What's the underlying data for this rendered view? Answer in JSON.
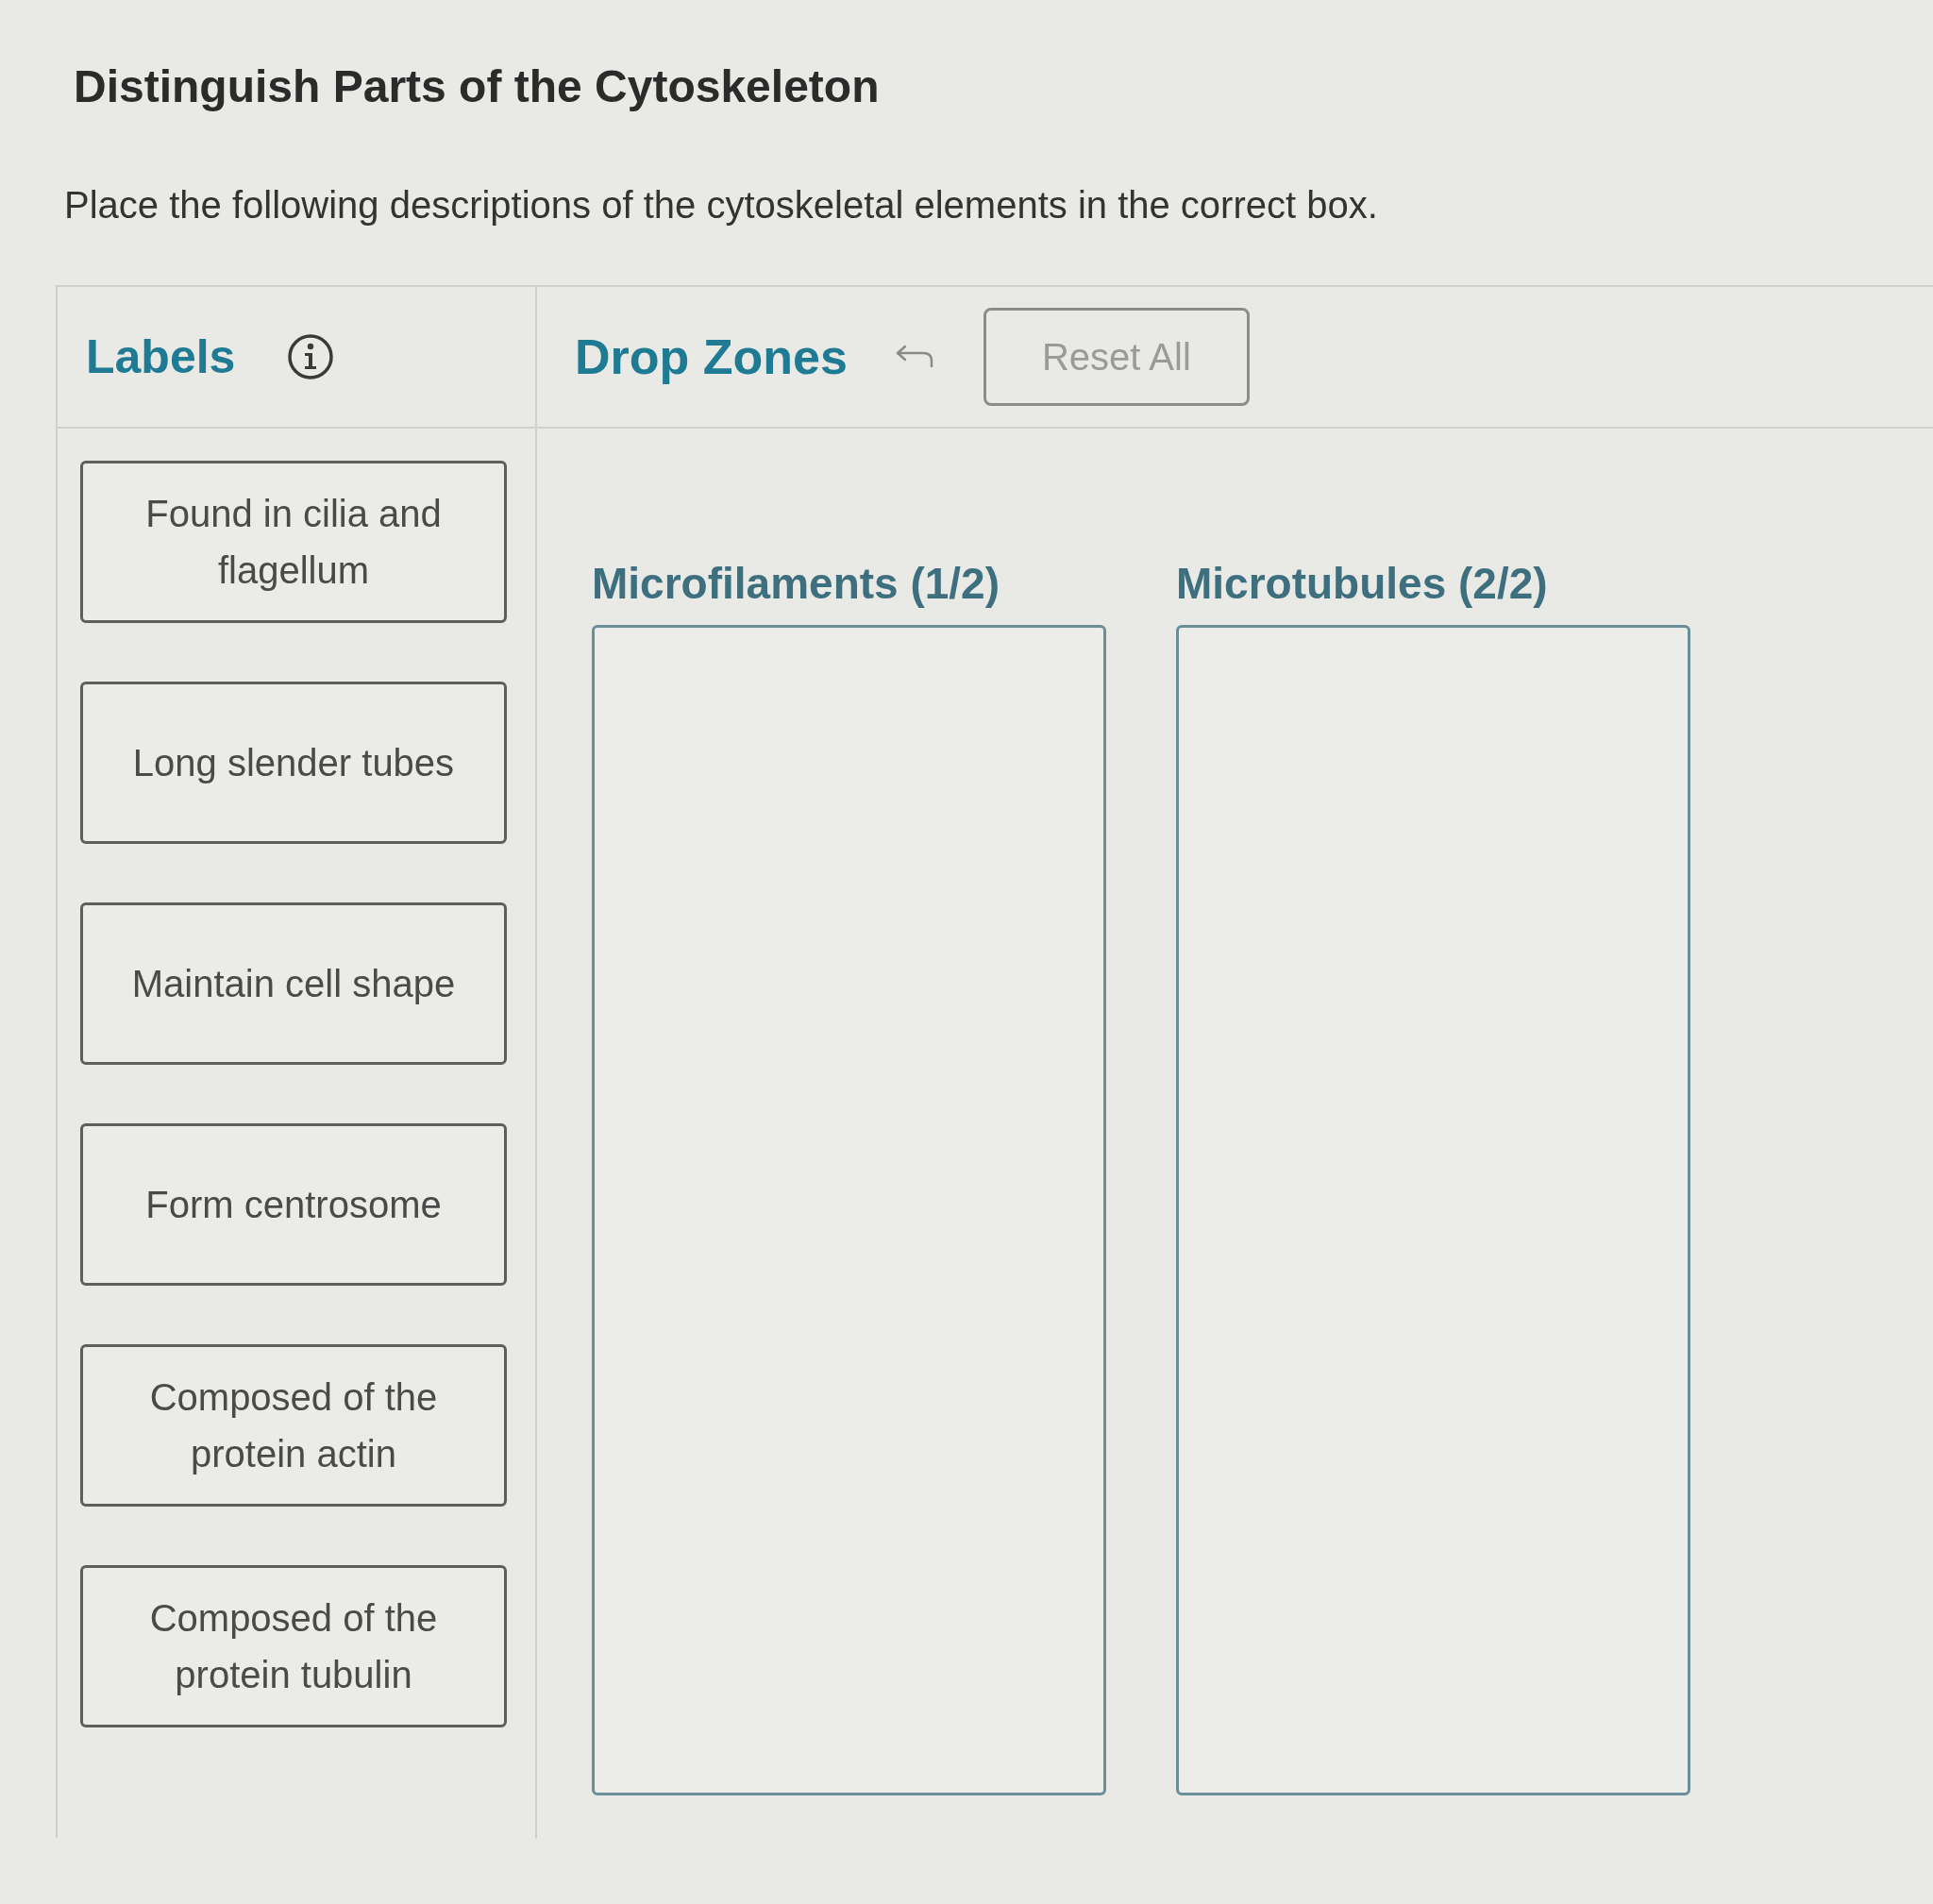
{
  "title": "Distinguish Parts of the Cytoskeleton",
  "instructions": "Place the following descriptions of the cytoskeletal elements in the correct box.",
  "labels_panel": {
    "heading": "Labels",
    "items": [
      {
        "text": "Found in cilia and flagellum"
      },
      {
        "text": "Long slender tubes"
      },
      {
        "text": "Maintain cell shape"
      },
      {
        "text": "Form centrosome"
      },
      {
        "text": "Composed of the protein actin"
      },
      {
        "text": "Composed of the protein tubulin"
      }
    ]
  },
  "drop_zones_panel": {
    "heading": "Drop Zones",
    "reset_button": {
      "label": "Reset All",
      "disabled": true
    },
    "zones": [
      {
        "title": "Microfilaments (1/2)"
      },
      {
        "title": "Microtubules (2/2)"
      }
    ]
  }
}
